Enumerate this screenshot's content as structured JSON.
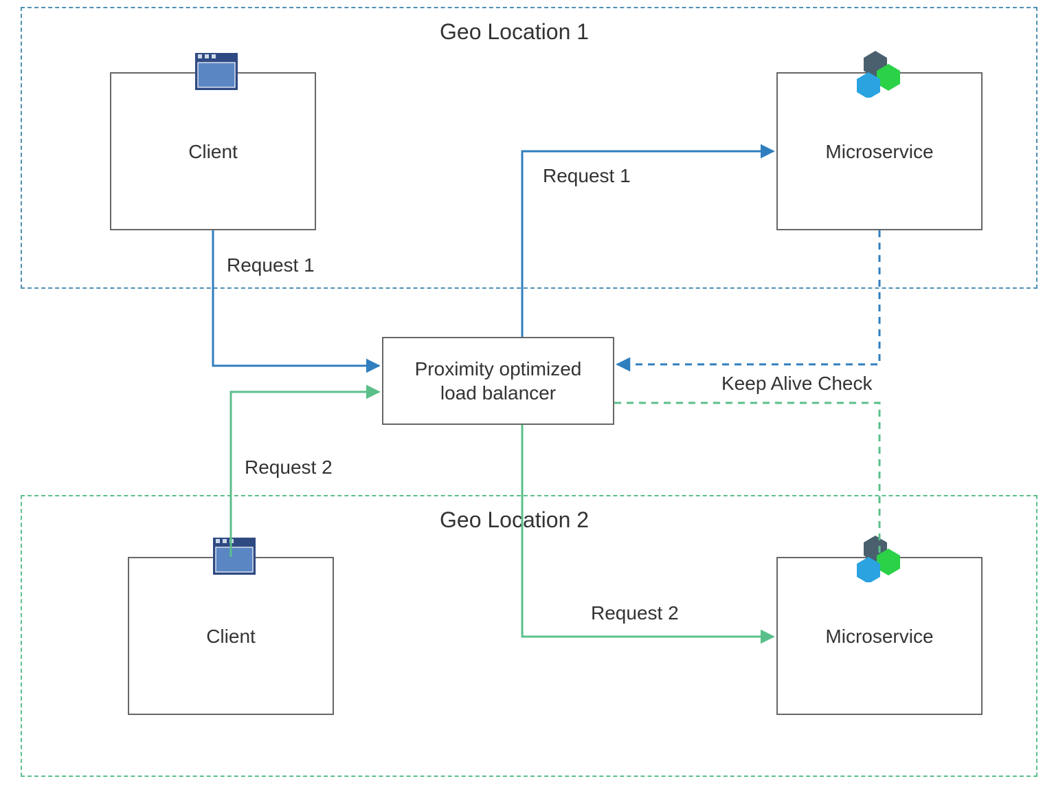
{
  "regions": {
    "loc1": {
      "title": "Geo Location 1"
    },
    "loc2": {
      "title": "Geo Location 2"
    }
  },
  "nodes": {
    "client1": {
      "label": "Client"
    },
    "client2": {
      "label": "Client"
    },
    "ms1": {
      "label": "Microservice"
    },
    "ms2": {
      "label": "Microservice"
    },
    "lb": {
      "label": "Proximity optimized\nload balancer"
    }
  },
  "edges": {
    "req1_client_to_lb": {
      "label": "Request 1"
    },
    "req1_lb_to_ms": {
      "label": "Request 1"
    },
    "req2_client_to_lb": {
      "label": "Request 2"
    },
    "req2_lb_to_ms": {
      "label": "Request 2"
    },
    "keepalive": {
      "label": "Keep Alive Check"
    }
  },
  "colors": {
    "blue": "#2f7fbf",
    "green": "#5bbf8a",
    "regionBlue": "#4f8fb3",
    "regionGreen": "#5bbf8a",
    "iconDark": "#4a606e",
    "iconBlue": "#2aa3e0",
    "iconGreen": "#2bd147",
    "clientFill": "#5a86c4",
    "clientFrame": "#2f4a82"
  }
}
